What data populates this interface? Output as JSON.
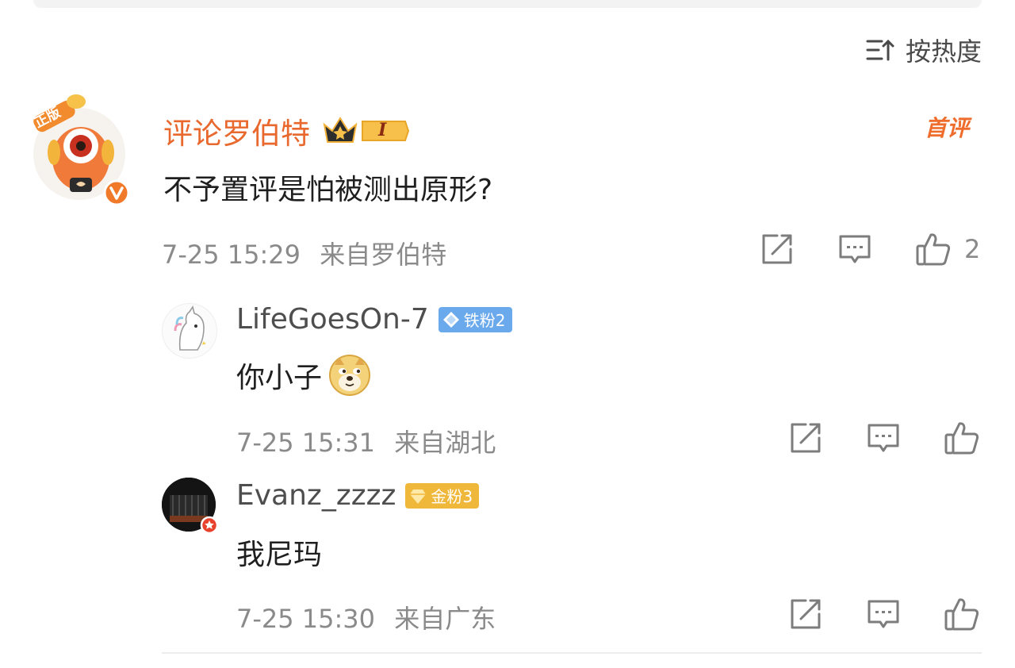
{
  "sort": {
    "label": "按热度"
  },
  "main_comment": {
    "author": "评论罗伯特",
    "avatar_badge": "正版",
    "level_badge": "I",
    "first_badge": "首评",
    "text": "不予置评是怕被测出原形?",
    "timestamp": "7-25 15:29",
    "source": "来自罗伯特",
    "likes": "2"
  },
  "replies": [
    {
      "author": "LifeGoesOn-7",
      "fan_badge": "铁粉2",
      "text": "你小子",
      "emoji": "doge-emoji",
      "timestamp": "7-25 15:31",
      "source": "来自湖北"
    },
    {
      "author": "Evanz_zzzz",
      "fan_badge": "金粉3",
      "text": "我尼玛",
      "timestamp": "7-25 15:30",
      "source": "来自广东"
    }
  ],
  "colors": {
    "author_orange": "#e8682d",
    "iron_fan_blue": "#6aa9ec",
    "gold_fan": "#f0b83b",
    "meta_gray": "#8a8a8a",
    "icon_gray": "#7d7d7d"
  },
  "icons": [
    "sort-icon",
    "share-icon",
    "comment-icon",
    "like-icon",
    "crown-icon",
    "diamond-icon",
    "verified-icon"
  ]
}
